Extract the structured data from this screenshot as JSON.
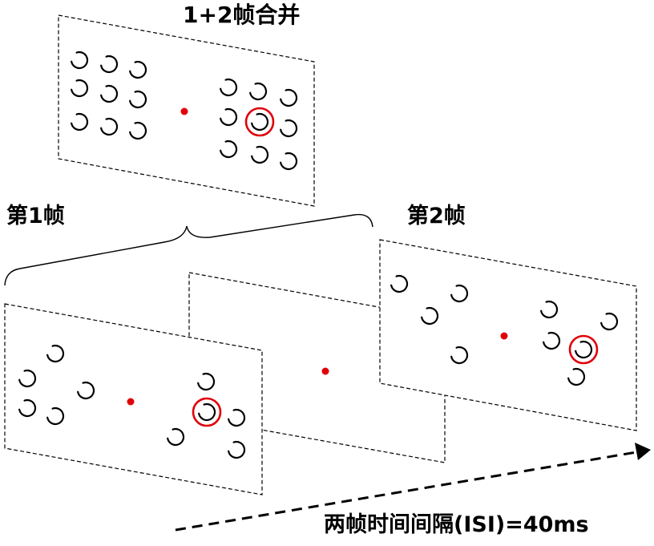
{
  "labels": {
    "merged_title": "1+2帧合并",
    "frame1_title": "第1帧",
    "frame2_title": "第2帧",
    "isi_caption": "两帧时间间隔(ISI)=40ms"
  },
  "colors": {
    "target_highlight": "#e0000a",
    "fixation_dot": "#e0000a",
    "panel_border": "#000000"
  }
}
